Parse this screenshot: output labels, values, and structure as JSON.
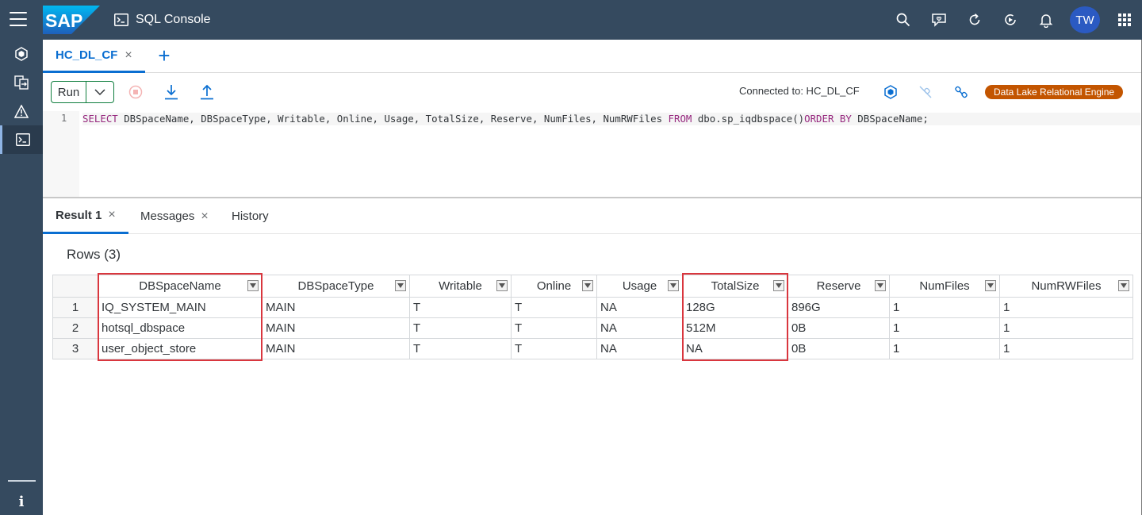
{
  "shell": {
    "logo_text": "SAP",
    "app_title": "SQL Console",
    "avatar_initials": "TW",
    "icons": [
      "search-icon",
      "feedback-icon",
      "refresh-icon",
      "play-icon",
      "bell-icon",
      "apps-grid-icon"
    ]
  },
  "sidenav": {
    "items": [
      "database-explorer-icon",
      "import-export-icon",
      "alerts-icon",
      "sql-console-icon"
    ],
    "info_label": "i"
  },
  "console_tab": {
    "label": "HC_DL_CF",
    "close": "×",
    "add": "+"
  },
  "toolbar": {
    "run_label": "Run",
    "connected_label": "Connected to: HC_DL_CF",
    "badge_label": "Data Lake Relational Engine",
    "badge_color": "#c35500"
  },
  "editor": {
    "line_number": "1",
    "sql_tokens": [
      {
        "text": "SELECT",
        "kw": true
      },
      {
        "text": " DBSpaceName, DBSpaceType, Writable, Online, Usage, TotalSize, Reserve, NumFiles, NumRWFiles ",
        "kw": false
      },
      {
        "text": "FROM",
        "kw": true
      },
      {
        "text": " dbo.sp_iqdbspace()",
        "kw": false
      },
      {
        "text": "ORDER BY",
        "kw": true
      },
      {
        "text": " DBSpaceName;",
        "kw": false
      }
    ]
  },
  "result_tabs": [
    {
      "label": "Result 1",
      "closable": true,
      "active": true
    },
    {
      "label": "Messages",
      "closable": true,
      "active": false
    },
    {
      "label": "History",
      "closable": false,
      "active": false
    }
  ],
  "rows_label": "Rows (3)",
  "table": {
    "columns": [
      "DBSpaceName",
      "DBSpaceType",
      "Writable",
      "Online",
      "Usage",
      "TotalSize",
      "Reserve",
      "NumFiles",
      "NumRWFiles"
    ],
    "rows": [
      {
        "index": "1",
        "cells": [
          "IQ_SYSTEM_MAIN",
          "MAIN",
          "T",
          "T",
          "NA",
          "128G",
          "896G",
          "1",
          "1"
        ]
      },
      {
        "index": "2",
        "cells": [
          "hotsql_dbspace",
          "MAIN",
          "T",
          "T",
          "NA",
          "512M",
          "0B",
          "1",
          "1"
        ]
      },
      {
        "index": "3",
        "cells": [
          "user_object_store",
          "MAIN",
          "T",
          "T",
          "NA",
          "NA",
          "0B",
          "1",
          "1"
        ]
      }
    ],
    "highlighted_columns": [
      "DBSpaceName",
      "TotalSize"
    ],
    "highlight_color": "#d9363e"
  },
  "colors": {
    "shell": "#354a5f",
    "accent": "#0a6ed1",
    "run_border": "#107e3e"
  }
}
